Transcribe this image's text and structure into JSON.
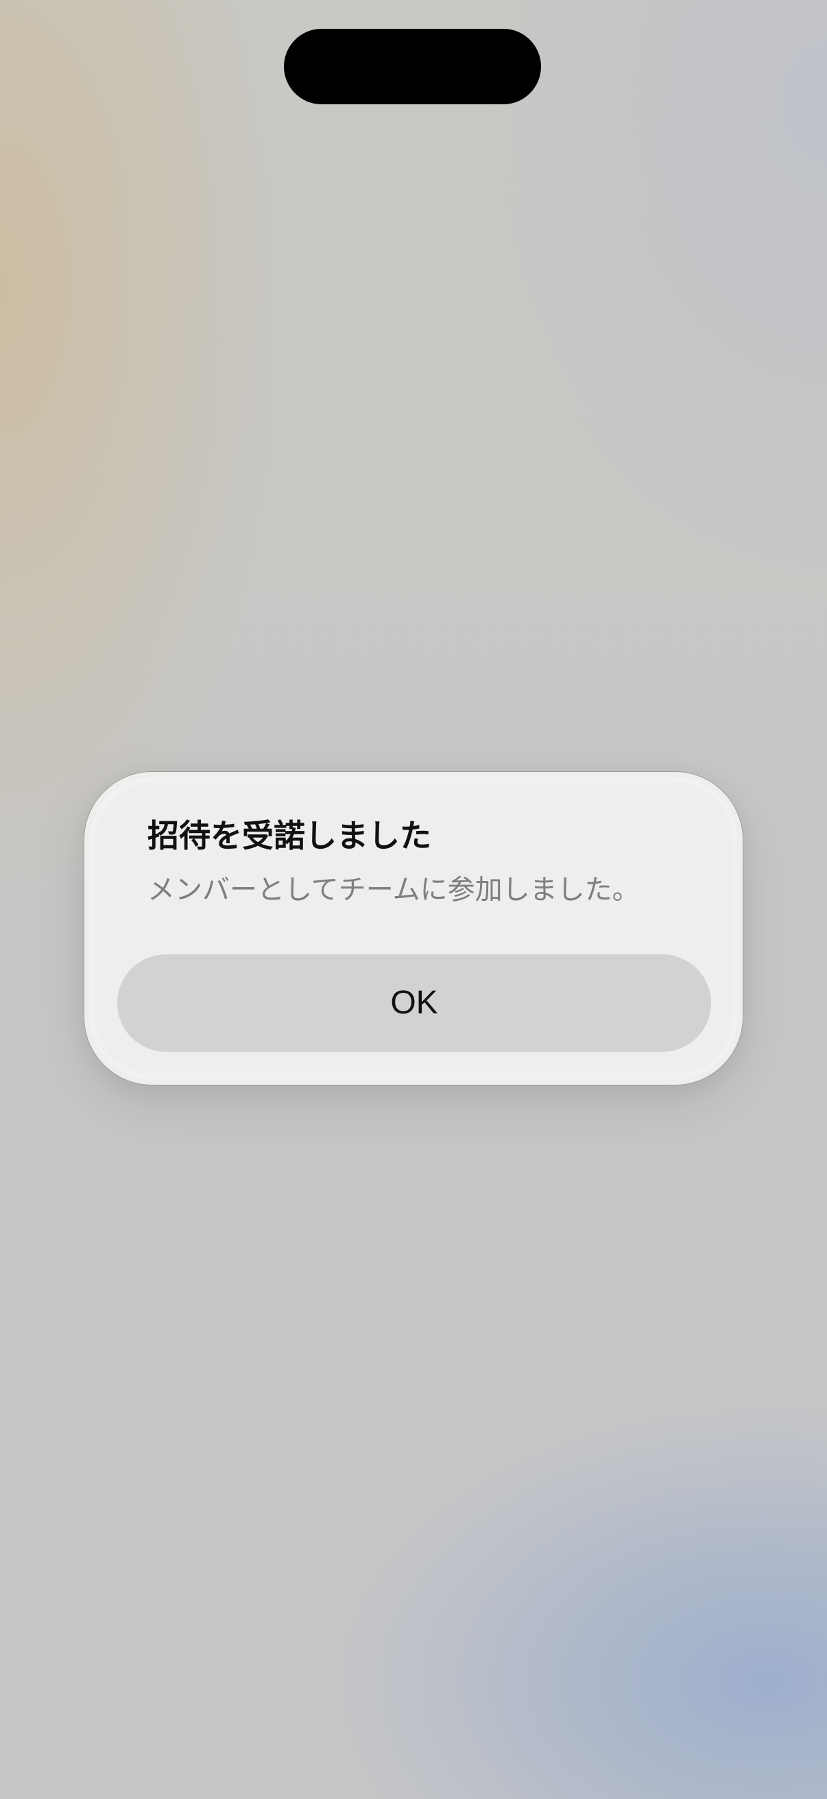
{
  "alert": {
    "title": "招待を受諾しました",
    "message": "メンバーとしてチームに参加しました。",
    "ok_label": "OK"
  }
}
